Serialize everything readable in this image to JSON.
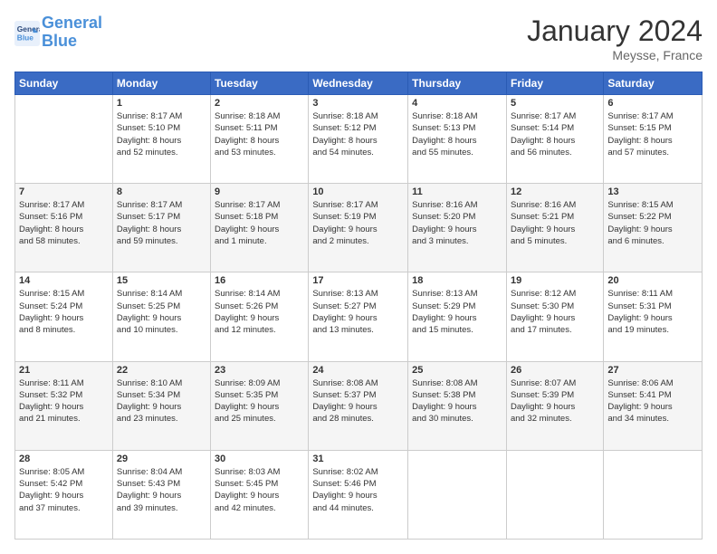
{
  "header": {
    "logo_line1": "General",
    "logo_line2": "Blue",
    "month": "January 2024",
    "location": "Meysse, France"
  },
  "weekdays": [
    "Sunday",
    "Monday",
    "Tuesday",
    "Wednesday",
    "Thursday",
    "Friday",
    "Saturday"
  ],
  "weeks": [
    [
      {
        "day": "",
        "info": ""
      },
      {
        "day": "1",
        "info": "Sunrise: 8:17 AM\nSunset: 5:10 PM\nDaylight: 8 hours\nand 52 minutes."
      },
      {
        "day": "2",
        "info": "Sunrise: 8:18 AM\nSunset: 5:11 PM\nDaylight: 8 hours\nand 53 minutes."
      },
      {
        "day": "3",
        "info": "Sunrise: 8:18 AM\nSunset: 5:12 PM\nDaylight: 8 hours\nand 54 minutes."
      },
      {
        "day": "4",
        "info": "Sunrise: 8:18 AM\nSunset: 5:13 PM\nDaylight: 8 hours\nand 55 minutes."
      },
      {
        "day": "5",
        "info": "Sunrise: 8:17 AM\nSunset: 5:14 PM\nDaylight: 8 hours\nand 56 minutes."
      },
      {
        "day": "6",
        "info": "Sunrise: 8:17 AM\nSunset: 5:15 PM\nDaylight: 8 hours\nand 57 minutes."
      }
    ],
    [
      {
        "day": "7",
        "info": "Sunrise: 8:17 AM\nSunset: 5:16 PM\nDaylight: 8 hours\nand 58 minutes."
      },
      {
        "day": "8",
        "info": "Sunrise: 8:17 AM\nSunset: 5:17 PM\nDaylight: 8 hours\nand 59 minutes."
      },
      {
        "day": "9",
        "info": "Sunrise: 8:17 AM\nSunset: 5:18 PM\nDaylight: 9 hours\nand 1 minute."
      },
      {
        "day": "10",
        "info": "Sunrise: 8:17 AM\nSunset: 5:19 PM\nDaylight: 9 hours\nand 2 minutes."
      },
      {
        "day": "11",
        "info": "Sunrise: 8:16 AM\nSunset: 5:20 PM\nDaylight: 9 hours\nand 3 minutes."
      },
      {
        "day": "12",
        "info": "Sunrise: 8:16 AM\nSunset: 5:21 PM\nDaylight: 9 hours\nand 5 minutes."
      },
      {
        "day": "13",
        "info": "Sunrise: 8:15 AM\nSunset: 5:22 PM\nDaylight: 9 hours\nand 6 minutes."
      }
    ],
    [
      {
        "day": "14",
        "info": "Sunrise: 8:15 AM\nSunset: 5:24 PM\nDaylight: 9 hours\nand 8 minutes."
      },
      {
        "day": "15",
        "info": "Sunrise: 8:14 AM\nSunset: 5:25 PM\nDaylight: 9 hours\nand 10 minutes."
      },
      {
        "day": "16",
        "info": "Sunrise: 8:14 AM\nSunset: 5:26 PM\nDaylight: 9 hours\nand 12 minutes."
      },
      {
        "day": "17",
        "info": "Sunrise: 8:13 AM\nSunset: 5:27 PM\nDaylight: 9 hours\nand 13 minutes."
      },
      {
        "day": "18",
        "info": "Sunrise: 8:13 AM\nSunset: 5:29 PM\nDaylight: 9 hours\nand 15 minutes."
      },
      {
        "day": "19",
        "info": "Sunrise: 8:12 AM\nSunset: 5:30 PM\nDaylight: 9 hours\nand 17 minutes."
      },
      {
        "day": "20",
        "info": "Sunrise: 8:11 AM\nSunset: 5:31 PM\nDaylight: 9 hours\nand 19 minutes."
      }
    ],
    [
      {
        "day": "21",
        "info": "Sunrise: 8:11 AM\nSunset: 5:32 PM\nDaylight: 9 hours\nand 21 minutes."
      },
      {
        "day": "22",
        "info": "Sunrise: 8:10 AM\nSunset: 5:34 PM\nDaylight: 9 hours\nand 23 minutes."
      },
      {
        "day": "23",
        "info": "Sunrise: 8:09 AM\nSunset: 5:35 PM\nDaylight: 9 hours\nand 25 minutes."
      },
      {
        "day": "24",
        "info": "Sunrise: 8:08 AM\nSunset: 5:37 PM\nDaylight: 9 hours\nand 28 minutes."
      },
      {
        "day": "25",
        "info": "Sunrise: 8:08 AM\nSunset: 5:38 PM\nDaylight: 9 hours\nand 30 minutes."
      },
      {
        "day": "26",
        "info": "Sunrise: 8:07 AM\nSunset: 5:39 PM\nDaylight: 9 hours\nand 32 minutes."
      },
      {
        "day": "27",
        "info": "Sunrise: 8:06 AM\nSunset: 5:41 PM\nDaylight: 9 hours\nand 34 minutes."
      }
    ],
    [
      {
        "day": "28",
        "info": "Sunrise: 8:05 AM\nSunset: 5:42 PM\nDaylight: 9 hours\nand 37 minutes."
      },
      {
        "day": "29",
        "info": "Sunrise: 8:04 AM\nSunset: 5:43 PM\nDaylight: 9 hours\nand 39 minutes."
      },
      {
        "day": "30",
        "info": "Sunrise: 8:03 AM\nSunset: 5:45 PM\nDaylight: 9 hours\nand 42 minutes."
      },
      {
        "day": "31",
        "info": "Sunrise: 8:02 AM\nSunset: 5:46 PM\nDaylight: 9 hours\nand 44 minutes."
      },
      {
        "day": "",
        "info": ""
      },
      {
        "day": "",
        "info": ""
      },
      {
        "day": "",
        "info": ""
      }
    ]
  ]
}
